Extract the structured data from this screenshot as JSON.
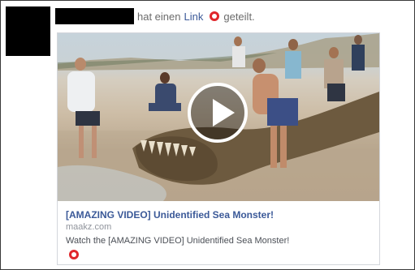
{
  "post": {
    "header_text_1": "hat einen",
    "header_link": "Link",
    "header_text_2": "geteilt.",
    "privacy_icon": "red-circle-icon"
  },
  "card": {
    "title": "[AMAZING VIDEO] Unidentified Sea Monster!",
    "domain": "maakz.com",
    "description": "Watch the [AMAZING VIDEO] Unidentified Sea Monster!",
    "thumbnail_icon": "play-icon",
    "footer_icon": "red-circle-icon"
  },
  "colors": {
    "link": "#3b5998",
    "meta_text": "#6b6b6b",
    "red_icon": "#e0262b",
    "border": "#3a3a3a"
  }
}
